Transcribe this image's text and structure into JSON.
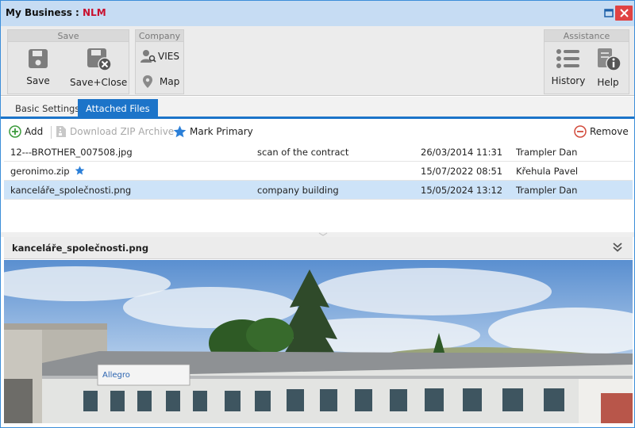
{
  "window": {
    "title_prefix": "My Business : ",
    "title_brand": "NLM",
    "accent": "#1c74c9"
  },
  "ribbon": {
    "save_group": {
      "header": "Save",
      "save_label": "Save",
      "save_close_label": "Save+Close"
    },
    "company_group": {
      "header": "Company",
      "vies_label": "VIES",
      "map_label": "Map"
    },
    "assistance_group": {
      "header": "Assistance",
      "history_label": "History",
      "help_label": "Help"
    }
  },
  "tabs": [
    {
      "label": "Basic Settings",
      "active": false
    },
    {
      "label": "Attached Files",
      "active": true
    }
  ],
  "toolbar": {
    "add_label": "Add",
    "download_label": "Download ZIP Archive",
    "mark_primary_label": "Mark Primary",
    "remove_label": "Remove"
  },
  "files": [
    {
      "name": "12---BROTHER_007508.jpg",
      "primary": false,
      "description": "scan of the contract",
      "date": "26/03/2014 11:31",
      "user": "Trampler Dan"
    },
    {
      "name": "geronimo.zip",
      "primary": true,
      "description": "",
      "date": "15/07/2022 08:51",
      "user": "Křehula Pavel"
    },
    {
      "name": "kanceláře_společnosti.png",
      "primary": false,
      "description": "company building",
      "date": "15/05/2024 13:12",
      "user": "Trampler Dan"
    }
  ],
  "preview": {
    "title": "kanceláře_společnosti.png",
    "sign_text": "Allegro"
  }
}
